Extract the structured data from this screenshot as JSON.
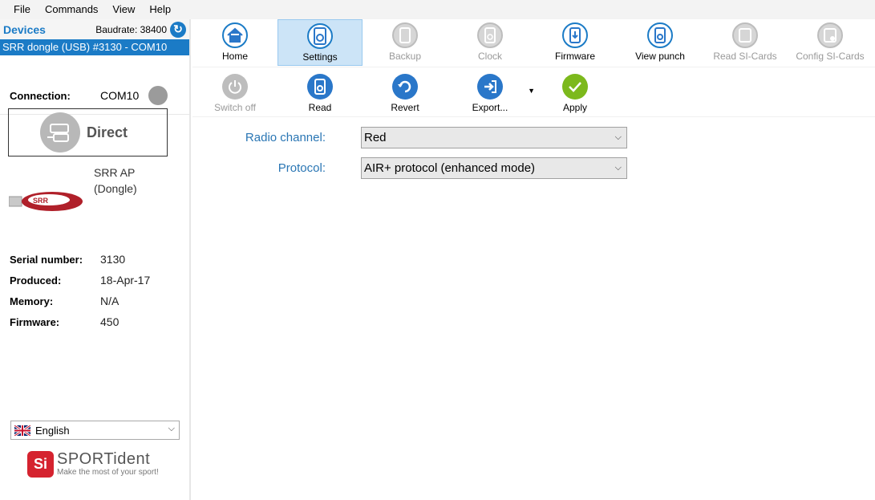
{
  "menu": [
    "File",
    "Commands",
    "View",
    "Help"
  ],
  "devices": {
    "title": "Devices",
    "baudrate": "Baudrate: 38400",
    "selected_device": "SRR dongle (USB) #3130 - COM10"
  },
  "connection": {
    "label": "Connection:",
    "port": "COM10",
    "mode": "Direct"
  },
  "device_name": [
    "SRR AP",
    "(Dongle)"
  ],
  "info": [
    {
      "key": "Serial number:",
      "value": "3130"
    },
    {
      "key": "Produced:",
      "value": "18-Apr-17"
    },
    {
      "key": "Memory:",
      "value": "N/A"
    },
    {
      "key": "Firmware:",
      "value": "450"
    }
  ],
  "language": "English",
  "logo": {
    "brand": "SPORTident",
    "tagline": "Make the most of your sport!",
    "mark": "Si"
  },
  "toolbar": [
    {
      "label": "Home",
      "icon": "home-icon",
      "state": "enabled"
    },
    {
      "label": "Settings",
      "icon": "settings-icon",
      "state": "active"
    },
    {
      "label": "Backup",
      "icon": "backup-icon",
      "state": "disabled"
    },
    {
      "label": "Clock",
      "icon": "clock-icon",
      "state": "disabled"
    },
    {
      "label": "Firmware",
      "icon": "firmware-icon",
      "state": "enabled"
    },
    {
      "label": "View punch",
      "icon": "view-punch-icon",
      "state": "enabled"
    },
    {
      "label": "Read SI-Cards",
      "icon": "read-si-cards-icon",
      "state": "disabled"
    },
    {
      "label": "Config SI-Cards",
      "icon": "config-si-cards-icon",
      "state": "disabled"
    }
  ],
  "actions": [
    {
      "label": "Switch off",
      "icon": "power-icon",
      "state": "disabled"
    },
    {
      "label": "Read",
      "icon": "read-icon",
      "state": "enabled"
    },
    {
      "label": "Revert",
      "icon": "revert-icon",
      "state": "enabled"
    },
    {
      "label": "Export...",
      "icon": "export-icon",
      "state": "enabled"
    },
    {
      "label": "Apply",
      "icon": "checkmark-icon",
      "state": "enabled"
    }
  ],
  "form": {
    "radio_channel_label": "Radio channel:",
    "radio_channel_value": "Red",
    "protocol_label": "Protocol:",
    "protocol_value": "AIR+ protocol (enhanced mode)"
  },
  "colors": {
    "accent": "#1b7bc6",
    "apply": "#7cb91c",
    "brand_red": "#d5232f"
  }
}
